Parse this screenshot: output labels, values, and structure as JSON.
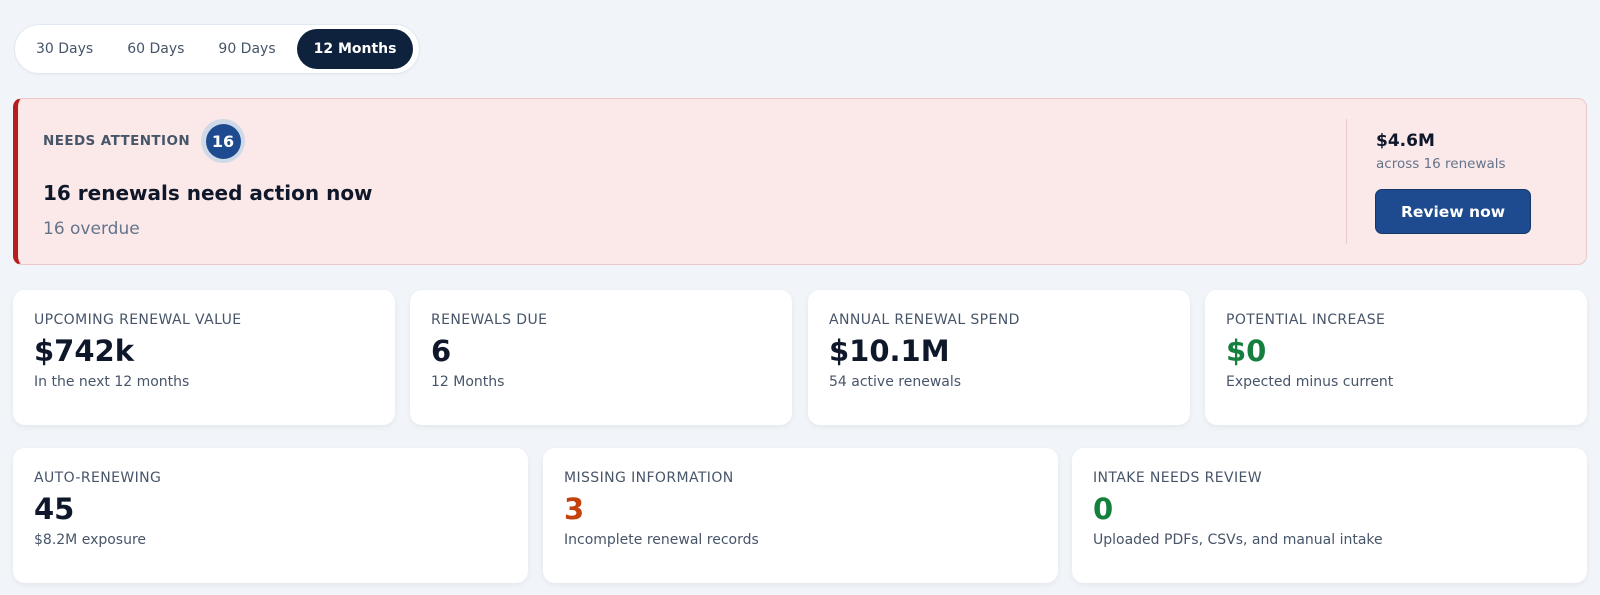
{
  "range_tabs": {
    "items": [
      {
        "label": "30 Days"
      },
      {
        "label": "60 Days"
      },
      {
        "label": "90 Days"
      },
      {
        "label": "12 Months"
      }
    ],
    "selected": "12 Months"
  },
  "alert": {
    "eyebrow": "NEEDS ATTENTION",
    "count": "16",
    "title": "16 renewals need action now",
    "subtitle": "16 overdue",
    "total_value": "$4.6M",
    "total_caption": "across 16 renewals",
    "action_label": "Review now",
    "accent_color": "#b91c1c",
    "background_color": "#fbe8e8"
  },
  "metrics_row1": [
    {
      "label": "UPCOMING RENEWAL VALUE",
      "value": "$742k",
      "caption": "In the next 12 months",
      "value_color": "#0f172a"
    },
    {
      "label": "RENEWALS DUE",
      "value": "6",
      "caption": "12 Months",
      "value_color": "#0f172a"
    },
    {
      "label": "ANNUAL RENEWAL SPEND",
      "value": "$10.1M",
      "caption": "54 active renewals",
      "value_color": "#0f172a"
    },
    {
      "label": "POTENTIAL INCREASE",
      "value": "$0",
      "caption": "Expected minus current",
      "value_color": "#15803d"
    }
  ],
  "metrics_row2": [
    {
      "label": "AUTO-RENEWING",
      "value": "45",
      "caption": "$8.2M exposure",
      "value_color": "#0f172a"
    },
    {
      "label": "MISSING INFORMATION",
      "value": "3",
      "caption": "Incomplete renewal records",
      "value_color": "#c2410c"
    },
    {
      "label": "INTAKE NEEDS REVIEW",
      "value": "0",
      "caption": "Uploaded PDFs, CSVs, and manual intake",
      "value_color": "#15803d"
    }
  ]
}
